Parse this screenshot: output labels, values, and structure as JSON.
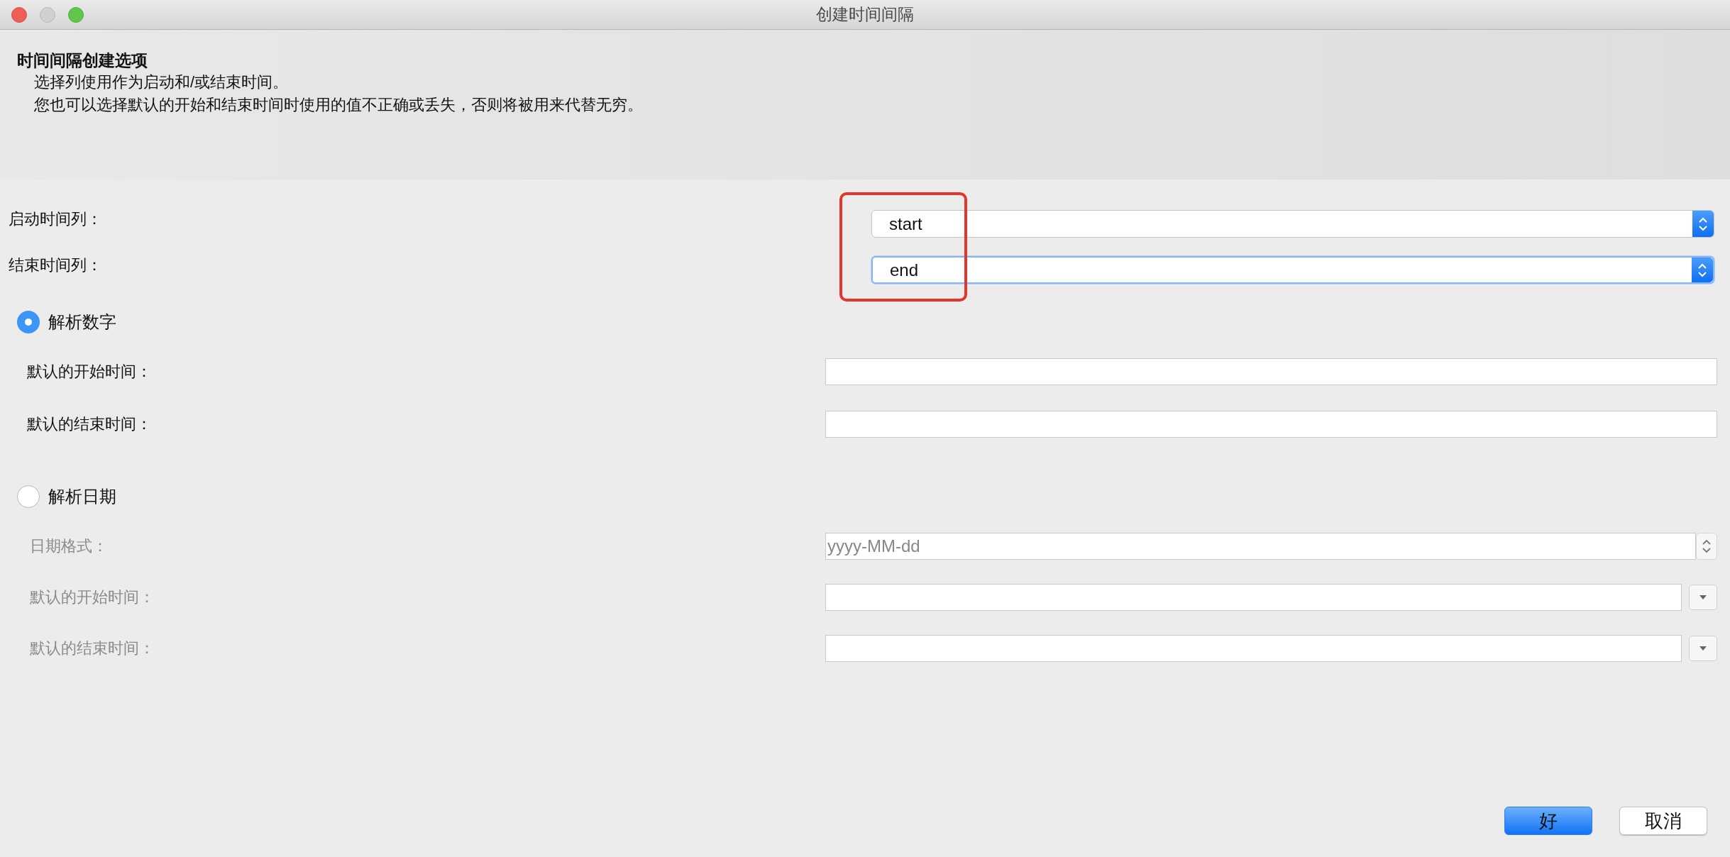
{
  "window": {
    "title": "创建时间间隔"
  },
  "header": {
    "title": "时间间隔创建选项",
    "lines": [
      "选择列使用作为启动和/或结束时间。",
      "您也可以选择默认的开始和结束时间时使用的值不正确或丢失，否则将被用来代替无穷。"
    ]
  },
  "column_fields": [
    {
      "label": "启动时间列：",
      "value": "start",
      "focused": false
    },
    {
      "label": "结束时间列：",
      "value": "end",
      "focused": true
    }
  ],
  "numeric_option": {
    "label": "解析数字",
    "selected": true,
    "fields": [
      {
        "label": "默认的开始时间："
      },
      {
        "label": "默认的结束时间："
      }
    ]
  },
  "date_option": {
    "label": "解析日期",
    "selected": false,
    "format": {
      "label": "日期格式：",
      "value": "yyyy-MM-dd"
    },
    "fields": [
      {
        "label": "默认的开始时间："
      },
      {
        "label": "默认的结束时间："
      }
    ]
  },
  "buttons": [
    {
      "label": "好",
      "kind": "primary"
    },
    {
      "label": "取消",
      "kind": "secondary"
    }
  ]
}
